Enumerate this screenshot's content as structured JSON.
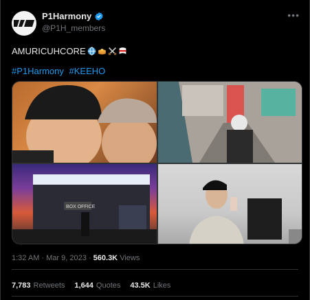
{
  "author": {
    "display_name": "P1Harmony",
    "handle": "@P1H_members",
    "avatar_label": "P1H",
    "verified": true
  },
  "tweet": {
    "text": "AMURICUHCORE",
    "emojis": [
      "globe-icon",
      "pancake-icon",
      "crossed-swords-icon",
      "flag-icon"
    ],
    "hashtags": [
      "#P1Harmony",
      "#KEEHO"
    ]
  },
  "media": [
    {
      "name": "selfie-photo"
    },
    {
      "name": "convenience-store-photo"
    },
    {
      "name": "box-office-photo"
    },
    {
      "name": "mirror-selfie-photo"
    }
  ],
  "meta": {
    "time": "1:32 AM",
    "sep": "·",
    "date": "Mar 9, 2023",
    "views_count": "560.3K",
    "views_label": "Views"
  },
  "stats": {
    "retweets_count": "7,783",
    "retweets_label": "Retweets",
    "quotes_count": "1,644",
    "quotes_label": "Quotes",
    "likes_count": "43.5K",
    "likes_label": "Likes"
  },
  "colors": {
    "background": "#000000",
    "text": "#e7e9ea",
    "muted": "#71767b",
    "link": "#1d9bf0",
    "divider": "#2f3336"
  }
}
